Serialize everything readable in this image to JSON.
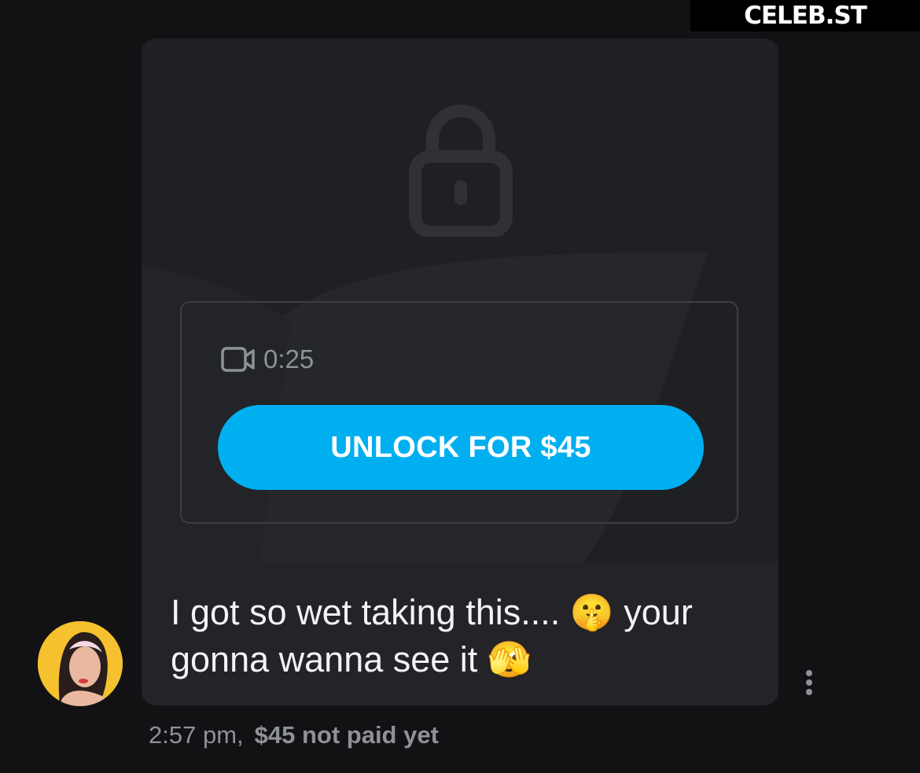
{
  "watermark": {
    "text": "CELEB.ST"
  },
  "message": {
    "media": {
      "locked_icon": "lock-icon",
      "media_type_icon": "video-camera-icon",
      "duration": "0:25",
      "unlock_label": "UNLOCK FOR $45",
      "accent_color": "#00aff0"
    },
    "text_line1": "I got so wet taking this.... 🤫 your",
    "text_line2": "gonna wanna see it 🫣",
    "time": "2:57 pm,",
    "payment_status": "$45 not paid yet"
  },
  "sender": {
    "avatar_icon": "avatar"
  },
  "actions": {
    "more_icon": "kebab-menu-icon"
  }
}
